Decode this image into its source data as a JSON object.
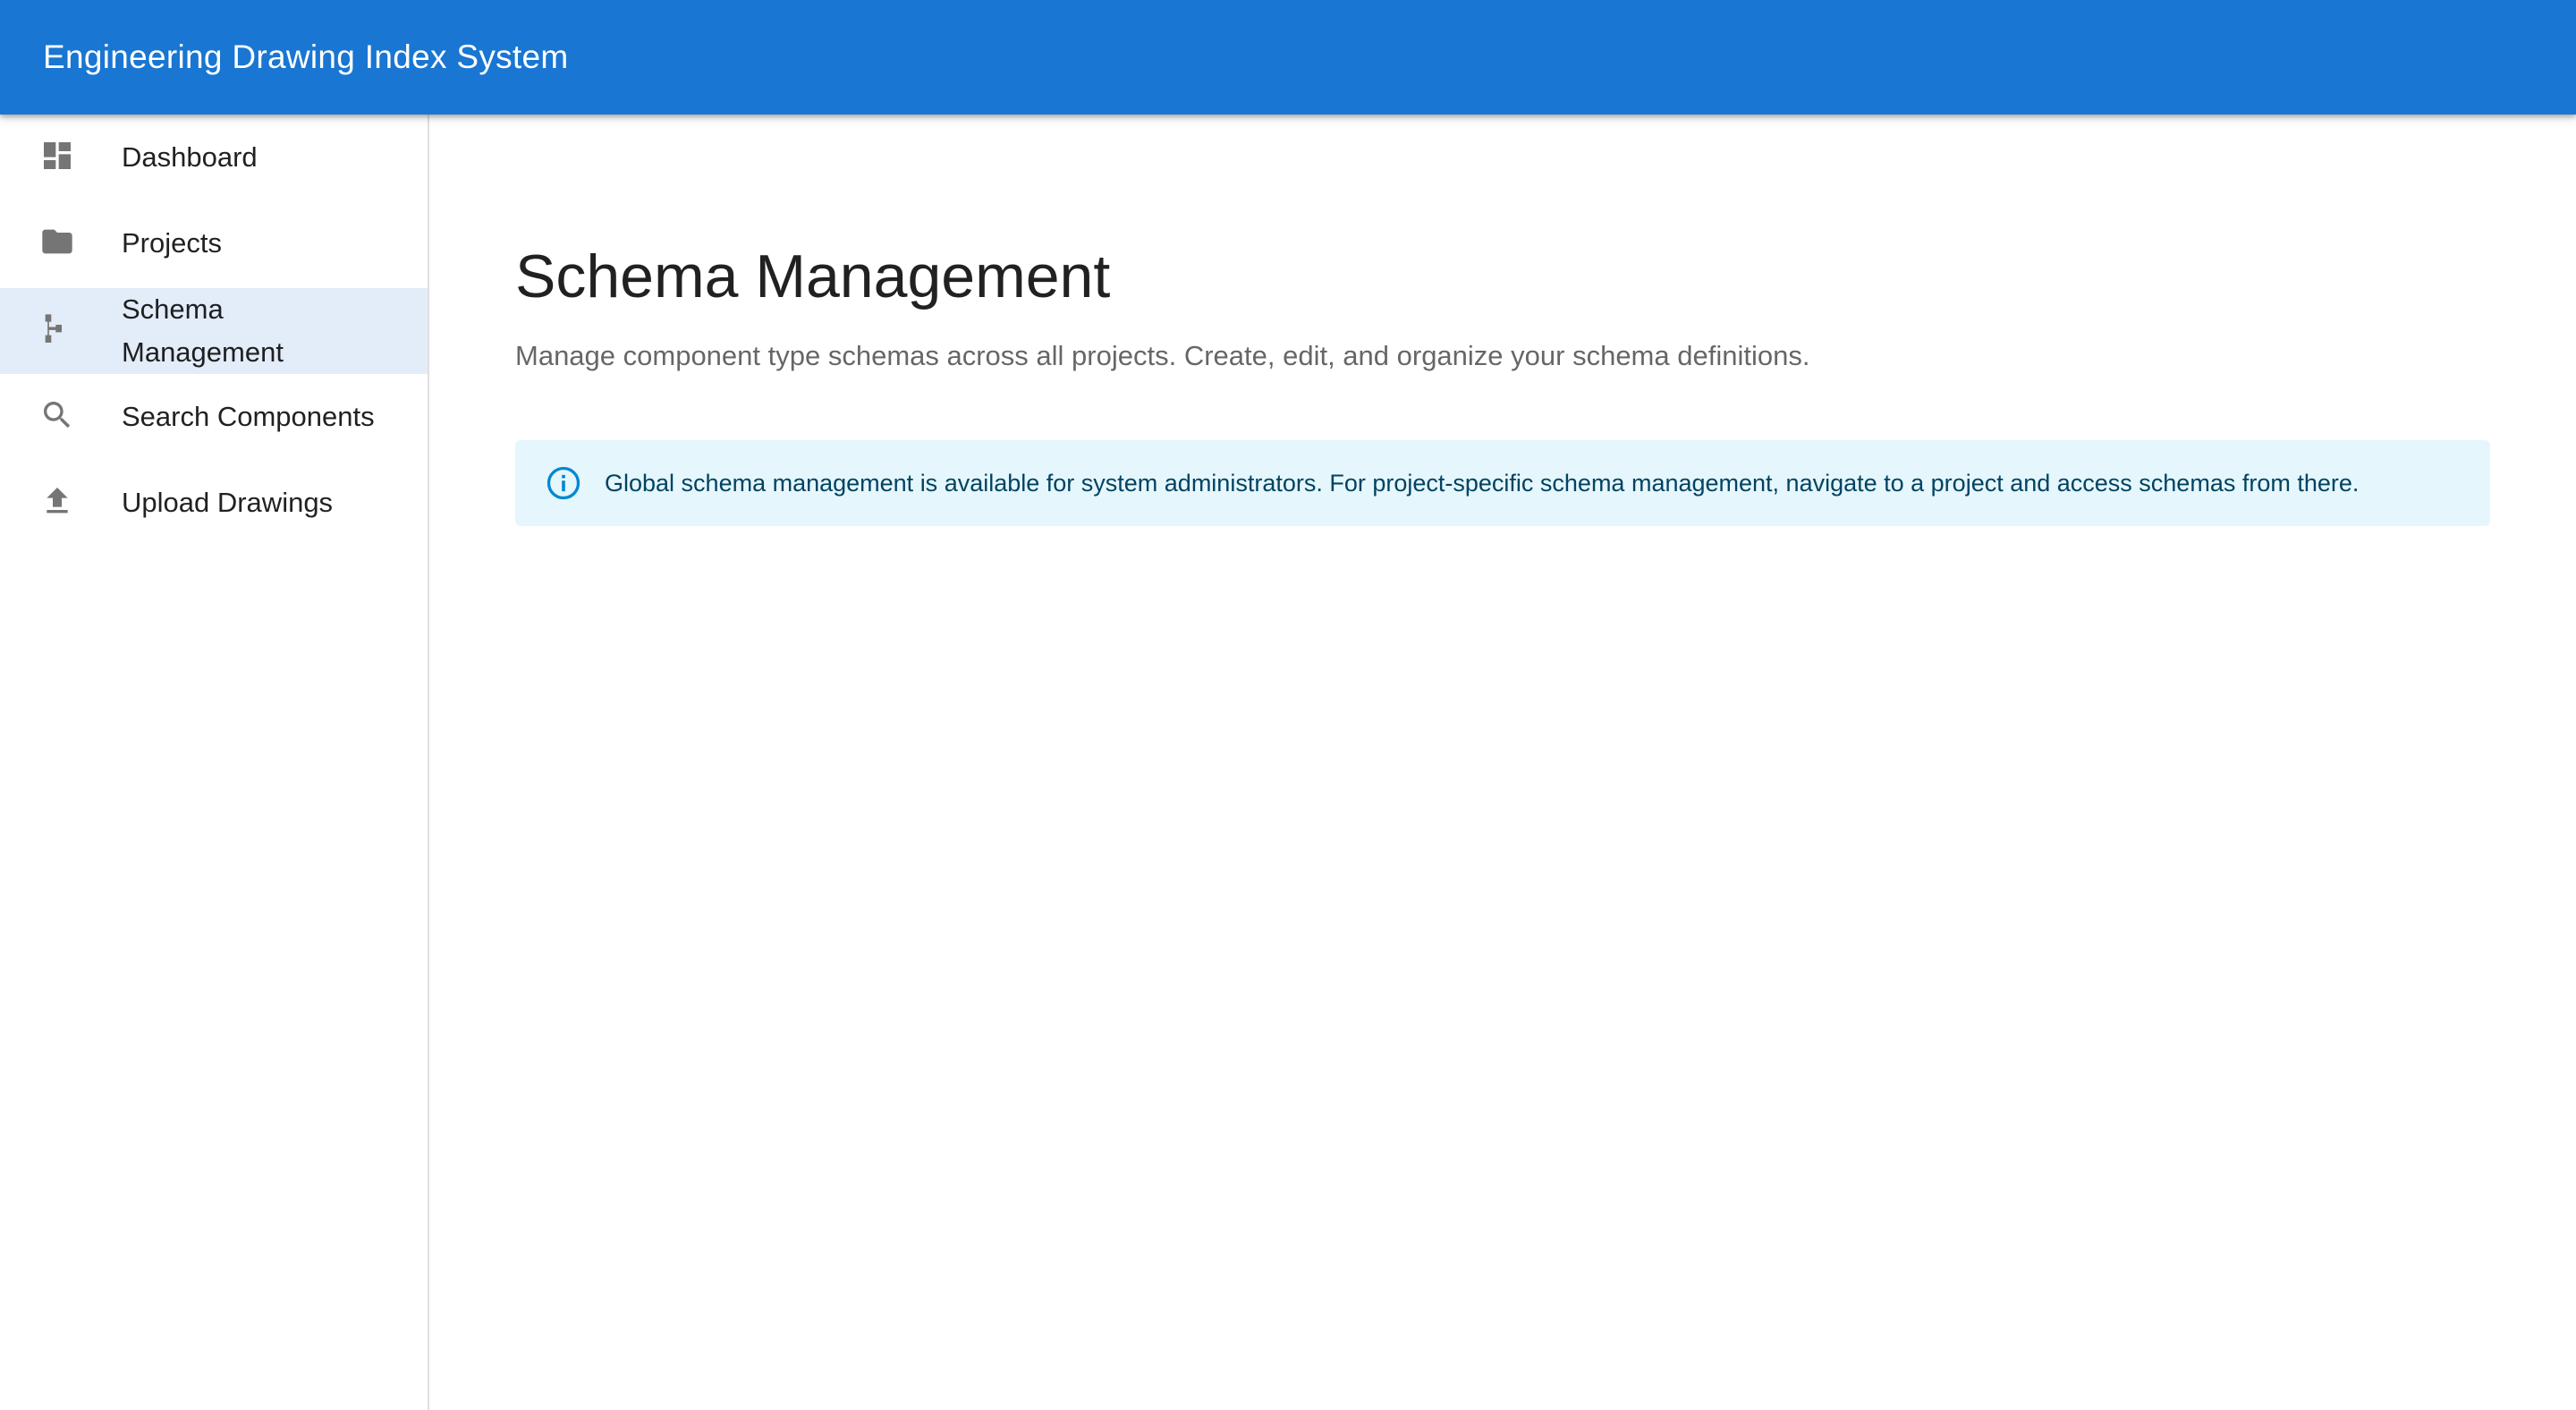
{
  "app": {
    "title": "Engineering Drawing Index System",
    "primary_color": "#1976d2"
  },
  "sidebar": {
    "items": [
      {
        "label": "Dashboard",
        "icon": "dashboard-icon",
        "selected": false
      },
      {
        "label": "Projects",
        "icon": "folder-icon",
        "selected": false
      },
      {
        "label": "Schema Management",
        "icon": "schema-icon",
        "selected": true
      },
      {
        "label": "Search Components",
        "icon": "search-icon",
        "selected": false
      },
      {
        "label": "Upload Drawings",
        "icon": "upload-icon",
        "selected": false
      }
    ]
  },
  "main": {
    "title": "Schema Management",
    "subtitle": "Manage component type schemas across all projects. Create, edit, and organize your schema definitions.",
    "alert": {
      "severity": "info",
      "icon": "info-icon",
      "text": "Global schema management is available for system administrators. For project-specific schema management, navigate to a project and access schemas from there.",
      "background": "#e5f6fd",
      "text_color": "#014361",
      "icon_color": "#0288d1"
    }
  }
}
